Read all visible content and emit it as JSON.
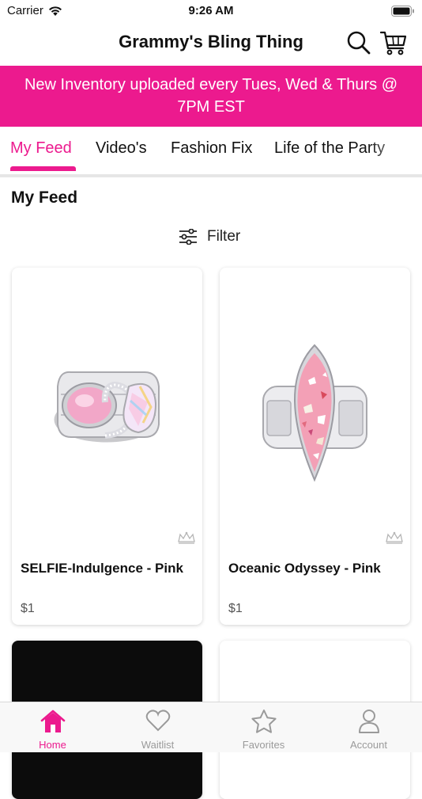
{
  "status_bar": {
    "carrier": "Carrier",
    "time": "9:26 AM"
  },
  "header": {
    "title": "Grammy's Bling Thing",
    "icons": [
      "search-icon",
      "cart-icon"
    ]
  },
  "banner": {
    "text": "New Inventory uploaded every Tues, Wed & Thurs @ 7PM EST"
  },
  "tabs": [
    {
      "label": "My Feed",
      "active": true
    },
    {
      "label": "Video's",
      "active": false
    },
    {
      "label": "Fashion Fix",
      "active": false
    },
    {
      "label": "Life of the Party",
      "active": false
    }
  ],
  "section_title": "My Feed",
  "filter": {
    "label": "Filter",
    "icon": "sliders-icon"
  },
  "products": [
    {
      "name": "SELFIE-Indulgence - Pink",
      "price": "$1"
    },
    {
      "name": "Oceanic Odyssey - Pink",
      "price": "$1"
    },
    {
      "name": "",
      "price": ""
    },
    {
      "name": "",
      "price": ""
    }
  ],
  "tabbar": [
    {
      "label": "Home",
      "icon": "home-icon",
      "active": true
    },
    {
      "label": "Waitlist",
      "icon": "heart-icon",
      "active": false
    },
    {
      "label": "Favorites",
      "icon": "star-icon",
      "active": false
    },
    {
      "label": "Account",
      "icon": "person-icon",
      "active": false
    }
  ],
  "colors": {
    "accent": "#ec1a8e",
    "inactive": "#9a9a9a"
  }
}
